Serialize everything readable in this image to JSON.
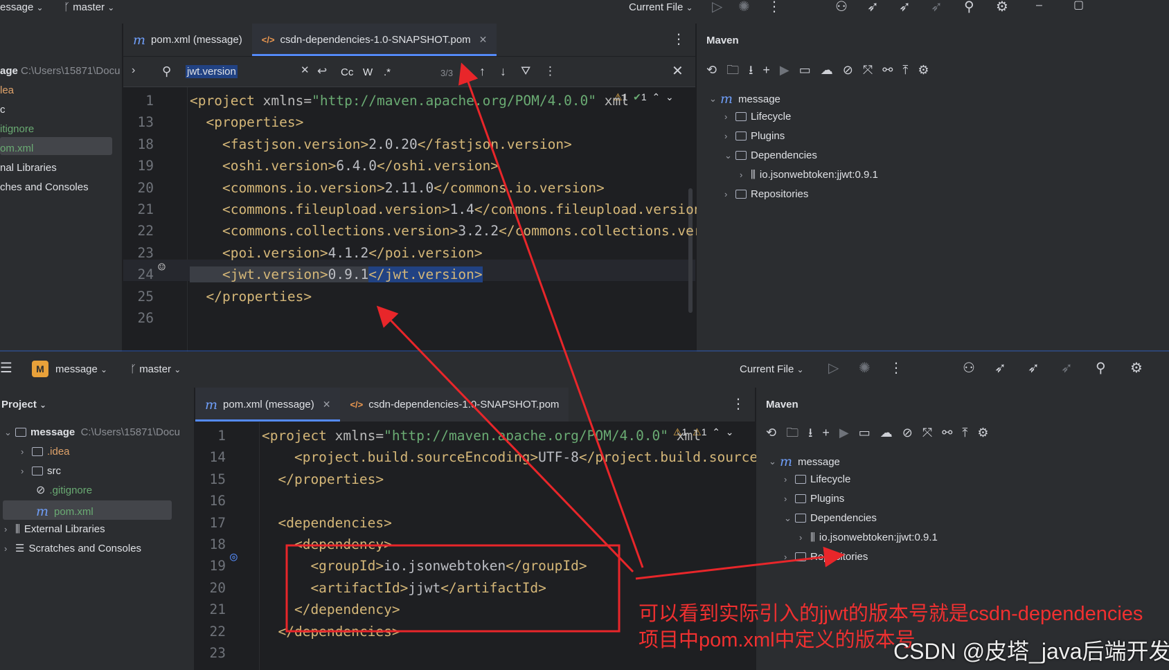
{
  "top": {
    "project_name": "message",
    "project_partial": "essage",
    "branch": "master",
    "run_config": "Current File",
    "project_badge": "M"
  },
  "win1": {
    "tabs": [
      {
        "label": "pom.xml (message)"
      },
      {
        "label": "csdn-dependencies-1.0-SNAPSHOT.pom"
      }
    ],
    "search": {
      "value": "jwt.version",
      "count": "3/3",
      "opt_case": "Cc",
      "opt_word": "W",
      "opt_regex": ".*"
    },
    "project_tree": [
      {
        "label": "age",
        "path": "C:\\Users\\15871\\Docu"
      },
      {
        "label": "lea"
      },
      {
        "label": "c"
      },
      {
        "label": "itignore"
      },
      {
        "label": "om.xml"
      },
      {
        "label": "nal Libraries"
      },
      {
        "label": "ches and Consoles"
      }
    ],
    "inspections": {
      "warn": "1",
      "ok": "1"
    },
    "lines": [
      {
        "n": "1",
        "parts": [
          [
            "tg",
            "<project "
          ],
          [
            "at",
            "xmlns="
          ],
          [
            "sv",
            "\"http://maven.apache.org/POM/4.0.0\""
          ],
          [
            "at",
            " xml"
          ]
        ]
      },
      {
        "n": "13",
        "parts": [
          [
            "tg",
            "  <properties>"
          ]
        ]
      },
      {
        "n": "18",
        "parts": [
          [
            "tg",
            "    <fastjson.version>"
          ],
          [
            "tx",
            "2.0.20"
          ],
          [
            "tg",
            "</fastjson.version>"
          ]
        ]
      },
      {
        "n": "19",
        "parts": [
          [
            "tg",
            "    <oshi.version>"
          ],
          [
            "tx",
            "6.4.0"
          ],
          [
            "tg",
            "</oshi.version>"
          ]
        ]
      },
      {
        "n": "20",
        "parts": [
          [
            "tg",
            "    <commons.io.version>"
          ],
          [
            "tx",
            "2.11.0"
          ],
          [
            "tg",
            "</commons.io.version>"
          ]
        ]
      },
      {
        "n": "21",
        "parts": [
          [
            "tg",
            "    <commons.fileupload.version>"
          ],
          [
            "tx",
            "1.4"
          ],
          [
            "tg",
            "</commons.fileupload.version>"
          ]
        ]
      },
      {
        "n": "22",
        "parts": [
          [
            "tg",
            "    <commons.collections.version>"
          ],
          [
            "tx",
            "3.2.2"
          ],
          [
            "tg",
            "</commons.collections.versio"
          ]
        ]
      },
      {
        "n": "23",
        "parts": [
          [
            "tg",
            "    <poi.version>"
          ],
          [
            "tx",
            "4.1.2"
          ],
          [
            "tg",
            "</poi.version>"
          ]
        ]
      },
      {
        "n": "24",
        "parts": [
          [
            "tg",
            "    <jwt.version>"
          ],
          [
            "tx",
            "0.9.1"
          ],
          [
            "tg",
            "</jwt.version>"
          ]
        ]
      },
      {
        "n": "25",
        "parts": [
          [
            "tg",
            "  </properties>"
          ]
        ]
      },
      {
        "n": "26",
        "parts": []
      }
    ]
  },
  "maven": {
    "title": "Maven",
    "root": "message",
    "lifecycle": "Lifecycle",
    "plugins": "Plugins",
    "dependencies": "Dependencies",
    "dep": "io.jsonwebtoken:jjwt:0.9.1",
    "repositories": "Repositories"
  },
  "win2": {
    "tabs": [
      {
        "label": "pom.xml (message)"
      },
      {
        "label": "csdn-dependencies-1.0-SNAPSHOT.pom"
      }
    ],
    "project_title": "Project",
    "project_tree": [
      {
        "label": "message",
        "path": "C:\\Users\\15871\\Docu"
      },
      {
        "label": ".idea"
      },
      {
        "label": "src"
      },
      {
        "label": ".gitignore"
      },
      {
        "label": "pom.xml"
      },
      {
        "label": "External Libraries"
      },
      {
        "label": "Scratches and Consoles"
      }
    ],
    "inspections": {
      "warn": "1",
      "warn2": "1"
    },
    "lines": [
      {
        "n": "1",
        "parts": [
          [
            "tg",
            "<project "
          ],
          [
            "at",
            "xmlns="
          ],
          [
            "sv",
            "\"http://maven.apache.org/POM/4.0.0\""
          ],
          [
            "at",
            " xml"
          ]
        ]
      },
      {
        "n": "14",
        "parts": [
          [
            "tg",
            "    <project.build.sourceEncoding>"
          ],
          [
            "tx",
            "UTF-8"
          ],
          [
            "tg",
            "</project.build.sourceEncod"
          ]
        ]
      },
      {
        "n": "15",
        "parts": [
          [
            "tg",
            "  </properties>"
          ]
        ]
      },
      {
        "n": "16",
        "parts": []
      },
      {
        "n": "17",
        "parts": [
          [
            "tg",
            "  <dependencies>"
          ]
        ]
      },
      {
        "n": "18",
        "parts": [
          [
            "tg",
            "    <dependency>"
          ]
        ]
      },
      {
        "n": "19",
        "parts": [
          [
            "tg",
            "      <groupId>"
          ],
          [
            "tx",
            "io.jsonwebtoken"
          ],
          [
            "tg",
            "</groupId>"
          ]
        ]
      },
      {
        "n": "20",
        "parts": [
          [
            "tg",
            "      <artifactId>"
          ],
          [
            "tx",
            "jjwt"
          ],
          [
            "tg",
            "</artifactId>"
          ]
        ]
      },
      {
        "n": "21",
        "parts": [
          [
            "tg",
            "    </dependency>"
          ]
        ]
      },
      {
        "n": "22",
        "parts": [
          [
            "tg",
            "  </dependencies>"
          ]
        ]
      },
      {
        "n": "23",
        "parts": []
      }
    ]
  },
  "annotation": {
    "line1": "可以看到实际引入的jjwt的版本号就是csdn-dependencies",
    "line2": "项目中pom.xml中定义的版本号"
  },
  "watermark": "CSDN @皮塔_java后端开发"
}
